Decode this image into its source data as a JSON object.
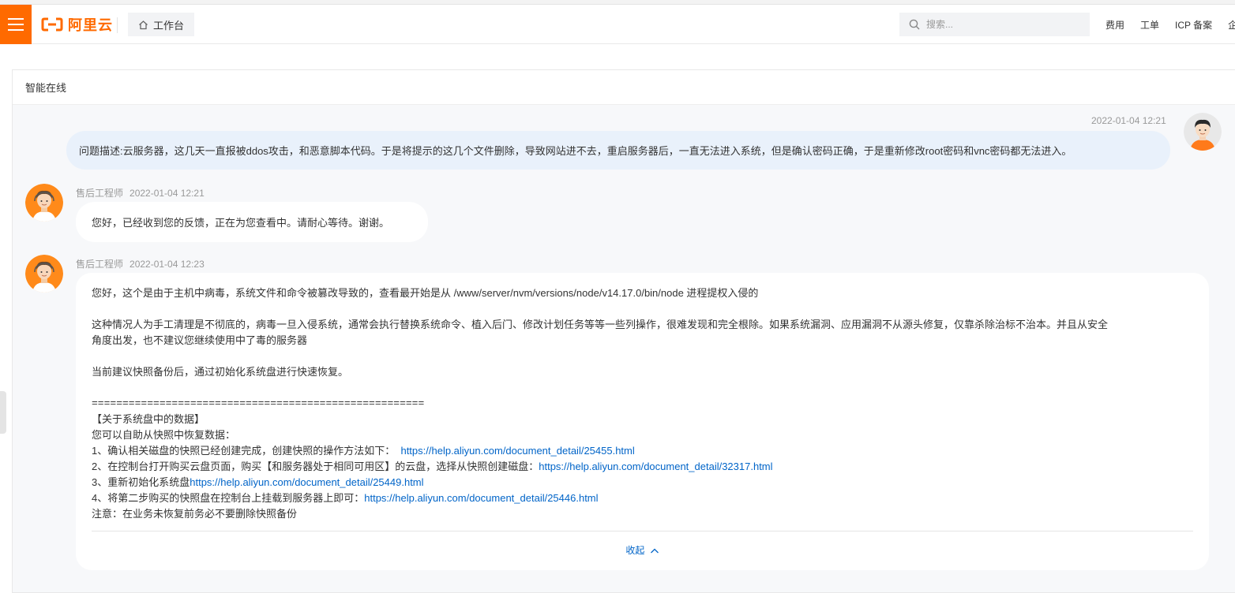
{
  "topbar": {
    "logo_text": "阿里云",
    "workbench_label": "工作台",
    "search_placeholder": "搜索...",
    "nav_links": [
      "费用",
      "工单",
      "ICP 备案",
      "企"
    ]
  },
  "panel": {
    "title": "智能在线"
  },
  "messages": {
    "user": {
      "time": "2022-01-04 12:21",
      "text": "问题描述:云服务器，这几天一直报被ddos攻击，和恶意脚本代码。于是将提示的这几个文件删除，导致网站进不去，重启服务器后，一直无法进入系统，但是确认密码正确，于是重新修改root密码和vnc密码都无法进入。"
    },
    "reply1": {
      "sender": "售后工程师",
      "time": "2022-01-04 12:21",
      "text": "您好，已经收到您的反馈，正在为您查看中。请耐心等待。谢谢。"
    },
    "reply2": {
      "sender": "售后工程师",
      "time": "2022-01-04 12:23",
      "para1": "您好，这个是由于主机中病毒，系统文件和命令被篡改导致的，查看最开始是从 /www/server/nvm/versions/node/v14.17.0/bin/node 进程提权入侵的",
      "para2_line1": "这种情况人为手工清理是不彻底的，病毒一旦入侵系统，通常会执行替换系统命令、植入后门、修改计划任务等等一些列操作，很难发现和完全根除。如果系统漏洞、应用漏洞不从源头修复，仅靠杀除治标不治本。并且从安全",
      "para2_line2": "角度出发，也不建议您继续使用中了毒的服务器",
      "para3": "当前建议快照备份后，通过初始化系统盘进行快速恢复。",
      "separator": "======================================================",
      "section_title": "【关于系统盘中的数据】",
      "intro": "您可以自助从快照中恢复数据：",
      "step1_text": "1、确认相关磁盘的快照已经创建完成，创建快照的操作方法如下：  ",
      "step1_link": "https://help.aliyun.com/document_detail/25455.html",
      "step2_text": "2、在控制台打开购买云盘页面，购买【和服务器处于相同可用区】的云盘，选择从快照创建磁盘：",
      "step2_link": "https://help.aliyun.com/document_detail/32317.html",
      "step3_text": "3、重新初始化系统盘",
      "step3_link": "https://help.aliyun.com/document_detail/25449.html",
      "step4_text": "4、将第二步购买的快照盘在控制台上挂载到服务器上即可：",
      "step4_link": "https://help.aliyun.com/document_detail/25446.html",
      "note": "注意：在业务未恢复前务必不要删除快照备份",
      "collapse_label": "收起"
    }
  },
  "colors": {
    "brand": "#ff6a00",
    "link": "#0064c8",
    "user_bubble": "#e9f1fb"
  },
  "icons": [
    "menu-icon",
    "aliyun-logo-icon",
    "home-icon",
    "search-icon",
    "chevron-up-icon",
    "user-avatar",
    "engineer-avatar"
  ]
}
